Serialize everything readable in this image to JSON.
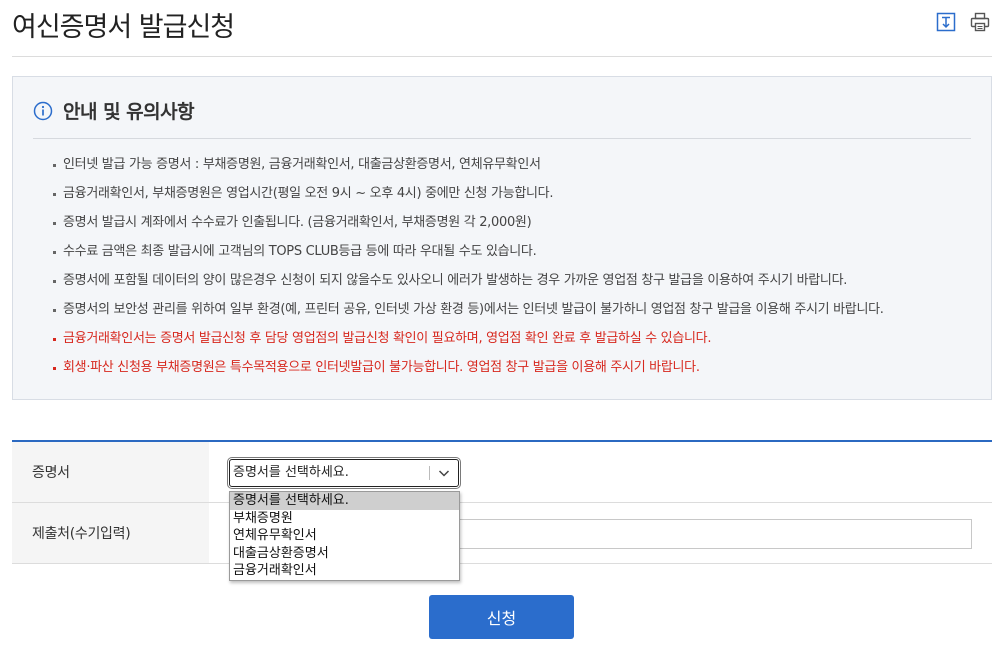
{
  "page": {
    "title": "여신증명서 발급신청",
    "tools": [
      "download-icon",
      "print-icon"
    ]
  },
  "notice": {
    "title": "안내 및 유의사항",
    "items": [
      {
        "text": "인터넷 발급 가능 증명서 : 부채증명원, 금융거래확인서, 대출금상환증명서, 연체유무확인서",
        "emphasis": false
      },
      {
        "text": "금융거래확인서, 부채증명원은 영업시간(평일 오전 9시 ~ 오후 4시) 중에만 신청 가능합니다.",
        "emphasis": false
      },
      {
        "text": "증명서 발급시 계좌에서 수수료가 인출됩니다. (금융거래확인서, 부채증명원 각 2,000원)",
        "emphasis": false
      },
      {
        "text": "수수료 금액은 최종 발급시에 고객님의 TOPS CLUB등급 등에 따라 우대될 수도 있습니다.",
        "emphasis": false
      },
      {
        "text": "증명서에 포함될 데이터의 양이 많은경우 신청이 되지 않을수도 있사오니 에러가 발생하는 경우 가까운 영업점 창구 발급을 이용하여 주시기 바랍니다.",
        "emphasis": false
      },
      {
        "text": "증명서의 보안성 관리를 위하여 일부 환경(예, 프린터 공유, 인터넷 가상 환경 등)에서는 인터넷 발급이 불가하니 영업점 창구 발급을 이용해 주시기 바랍니다.",
        "emphasis": false
      },
      {
        "text": "금융거래확인서는 증명서 발급신청 후 담당 영업점의 발급신청 확인이 필요하며, 영업점 확인 완료 후 발급하실 수 있습니다.",
        "emphasis": true
      },
      {
        "text": "회생·파산 신청용 부채증명원은 특수목적용으로 인터넷발급이 불가능합니다. 영업점 창구 발급을 이용해 주시기 바랍니다.",
        "emphasis": true
      }
    ]
  },
  "form": {
    "certificate_label": "증명서",
    "certificate_selected": "증명서를 선택하세요.",
    "certificate_options": [
      "증명서를 선택하세요.",
      "부채증명원",
      "연체유무확인서",
      "대출금상환증명서",
      "금융거래확인서"
    ],
    "recipient_label": "제출처(수기입력)",
    "recipient_value": ""
  },
  "submit_label": "신청",
  "colors": {
    "accent": "#2b6dcc",
    "warning_text": "#d7281e",
    "notice_bg": "#f4f6f9"
  }
}
